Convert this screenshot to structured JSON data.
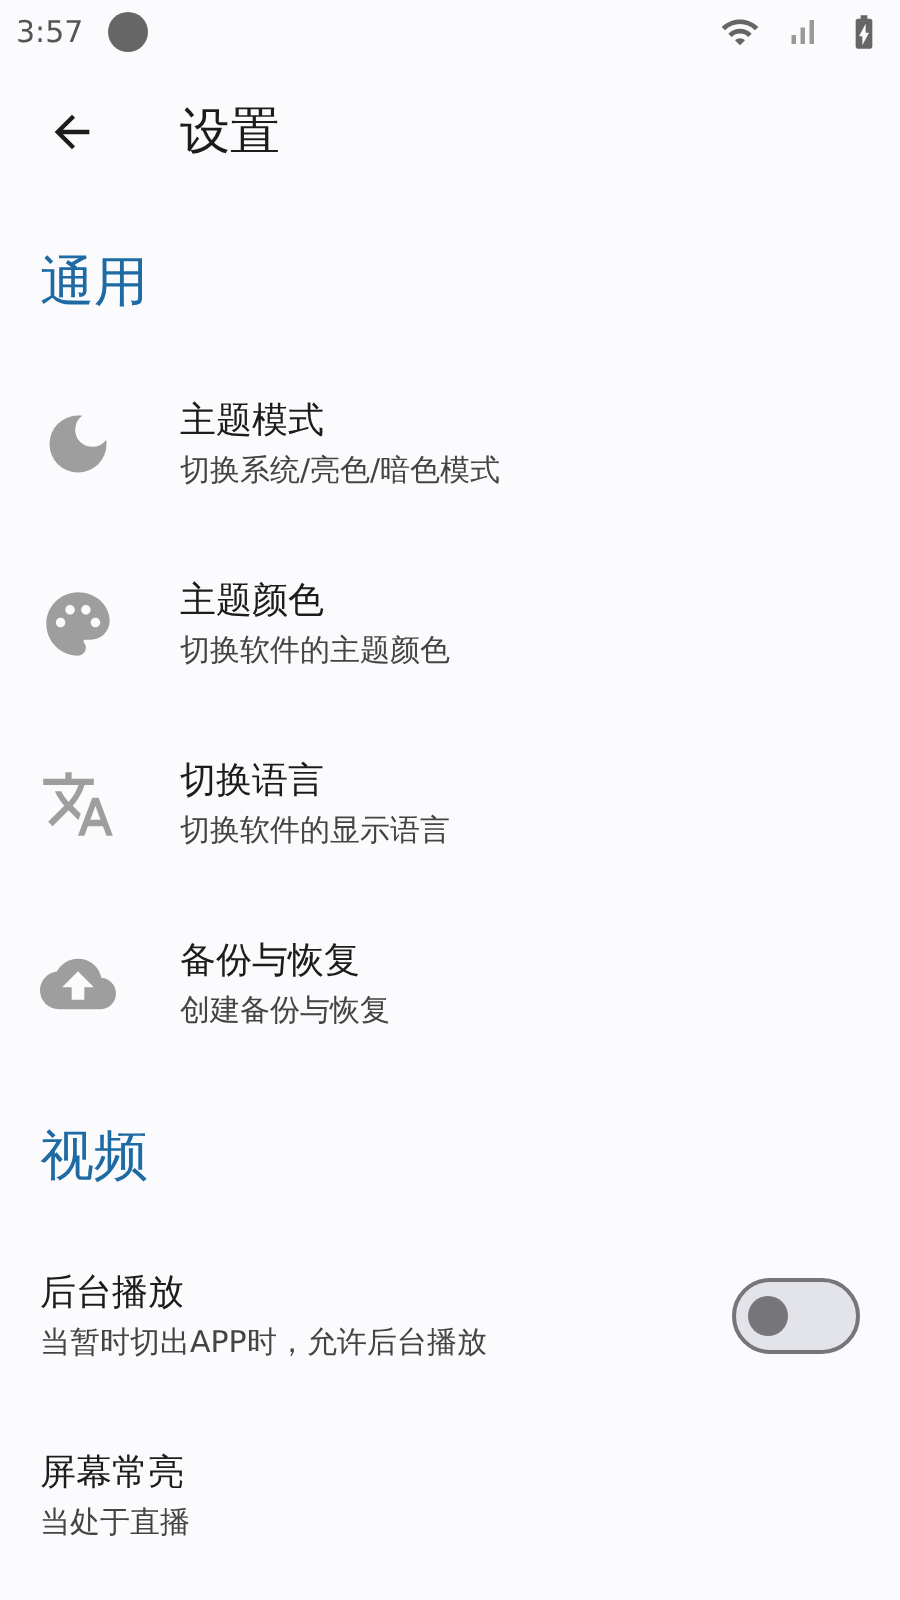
{
  "status_bar": {
    "time": "3:57"
  },
  "app_bar": {
    "title": "设置"
  },
  "sections": [
    {
      "title": "通用",
      "items": [
        {
          "kind": "link",
          "title": "主题模式",
          "subtitle": "切换系统/亮色/暗色模式"
        },
        {
          "kind": "link",
          "title": "主题颜色",
          "subtitle": "切换软件的主题颜色"
        },
        {
          "kind": "link",
          "title": "切换语言",
          "subtitle": "切换软件的显示语言"
        },
        {
          "kind": "link",
          "title": "备份与恢复",
          "subtitle": "创建备份与恢复"
        }
      ]
    },
    {
      "title": "视频",
      "items": [
        {
          "kind": "switch",
          "title": "后台播放",
          "subtitle": "当暂时切出APP时，允许后台播放",
          "on": false
        },
        {
          "kind": "plain",
          "title": "屏幕常亮",
          "subtitle": "当处于直播"
        }
      ]
    }
  ]
}
